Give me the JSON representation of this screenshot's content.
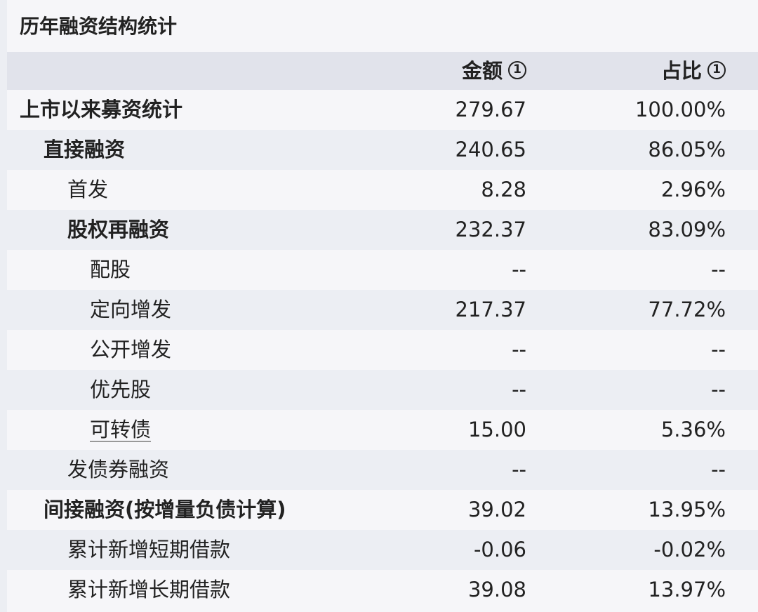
{
  "title": "历年融资结构统计",
  "header": {
    "amount_label": "金额",
    "ratio_label": "占比",
    "info_glyph": "1"
  },
  "rows": [
    {
      "label": "上市以来募资统计",
      "amount": "279.67",
      "ratio": "100.00%",
      "bold": true,
      "indent": 0,
      "link": false
    },
    {
      "label": "直接融资",
      "amount": "240.65",
      "ratio": "86.05%",
      "bold": true,
      "indent": 1,
      "link": false
    },
    {
      "label": "首发",
      "amount": "8.28",
      "ratio": "2.96%",
      "bold": false,
      "indent": 2,
      "link": false
    },
    {
      "label": "股权再融资",
      "amount": "232.37",
      "ratio": "83.09%",
      "bold": true,
      "indent": 2,
      "link": false
    },
    {
      "label": "配股",
      "amount": "--",
      "ratio": "--",
      "bold": false,
      "indent": 3,
      "link": false
    },
    {
      "label": "定向增发",
      "amount": "217.37",
      "ratio": "77.72%",
      "bold": false,
      "indent": 3,
      "link": false
    },
    {
      "label": "公开增发",
      "amount": "--",
      "ratio": "--",
      "bold": false,
      "indent": 3,
      "link": false
    },
    {
      "label": "优先股",
      "amount": "--",
      "ratio": "--",
      "bold": false,
      "indent": 3,
      "link": false
    },
    {
      "label": "可转债",
      "amount": "15.00",
      "ratio": "5.36%",
      "bold": false,
      "indent": 3,
      "link": true
    },
    {
      "label": "发债券融资",
      "amount": "--",
      "ratio": "--",
      "bold": false,
      "indent": 2,
      "link": false
    },
    {
      "label": "间接融资(按增量负债计算)",
      "amount": "39.02",
      "ratio": "13.95%",
      "bold": true,
      "indent": 1,
      "link": false
    },
    {
      "label": "累计新增短期借款",
      "amount": "-0.06",
      "ratio": "-0.02%",
      "bold": false,
      "indent": 2,
      "link": false
    },
    {
      "label": "累计新增长期借款",
      "amount": "39.08",
      "ratio": "13.97%",
      "bold": false,
      "indent": 2,
      "link": false
    }
  ]
}
